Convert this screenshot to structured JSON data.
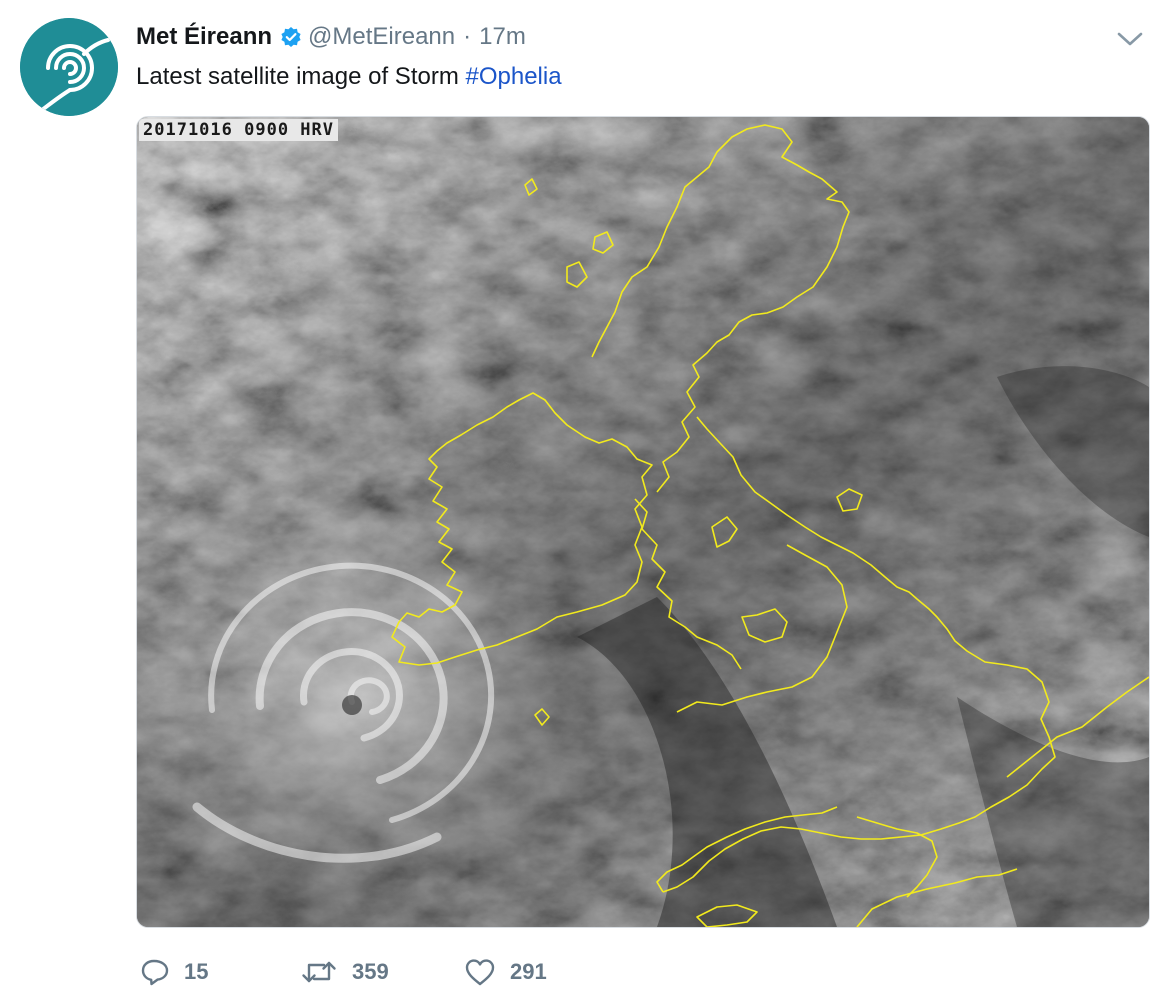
{
  "tweet": {
    "author_name": "Met Éireann",
    "handle": "@MetEireann",
    "separator": "·",
    "time": "17m",
    "text_prefix": "Latest satellite image of Storm ",
    "hashtag": "#Ophelia",
    "verified": true
  },
  "media": {
    "overlay_text": "20171016 0900 HRV"
  },
  "actions": {
    "replies": "15",
    "retweets": "359",
    "likes": "291"
  },
  "icons": {
    "avatar": "met-eireann-logo-icon",
    "verified": "verified-badge-icon",
    "menu": "chevron-down-icon",
    "reply": "reply-icon",
    "retweet": "retweet-icon",
    "like": "heart-icon"
  },
  "colors": {
    "brand_teal": "#1f8d96",
    "link_blue": "#1b55c9",
    "muted_gray": "#657786",
    "verified_blue": "#1da1f2",
    "coastline_yellow": "#f2ea1d"
  }
}
